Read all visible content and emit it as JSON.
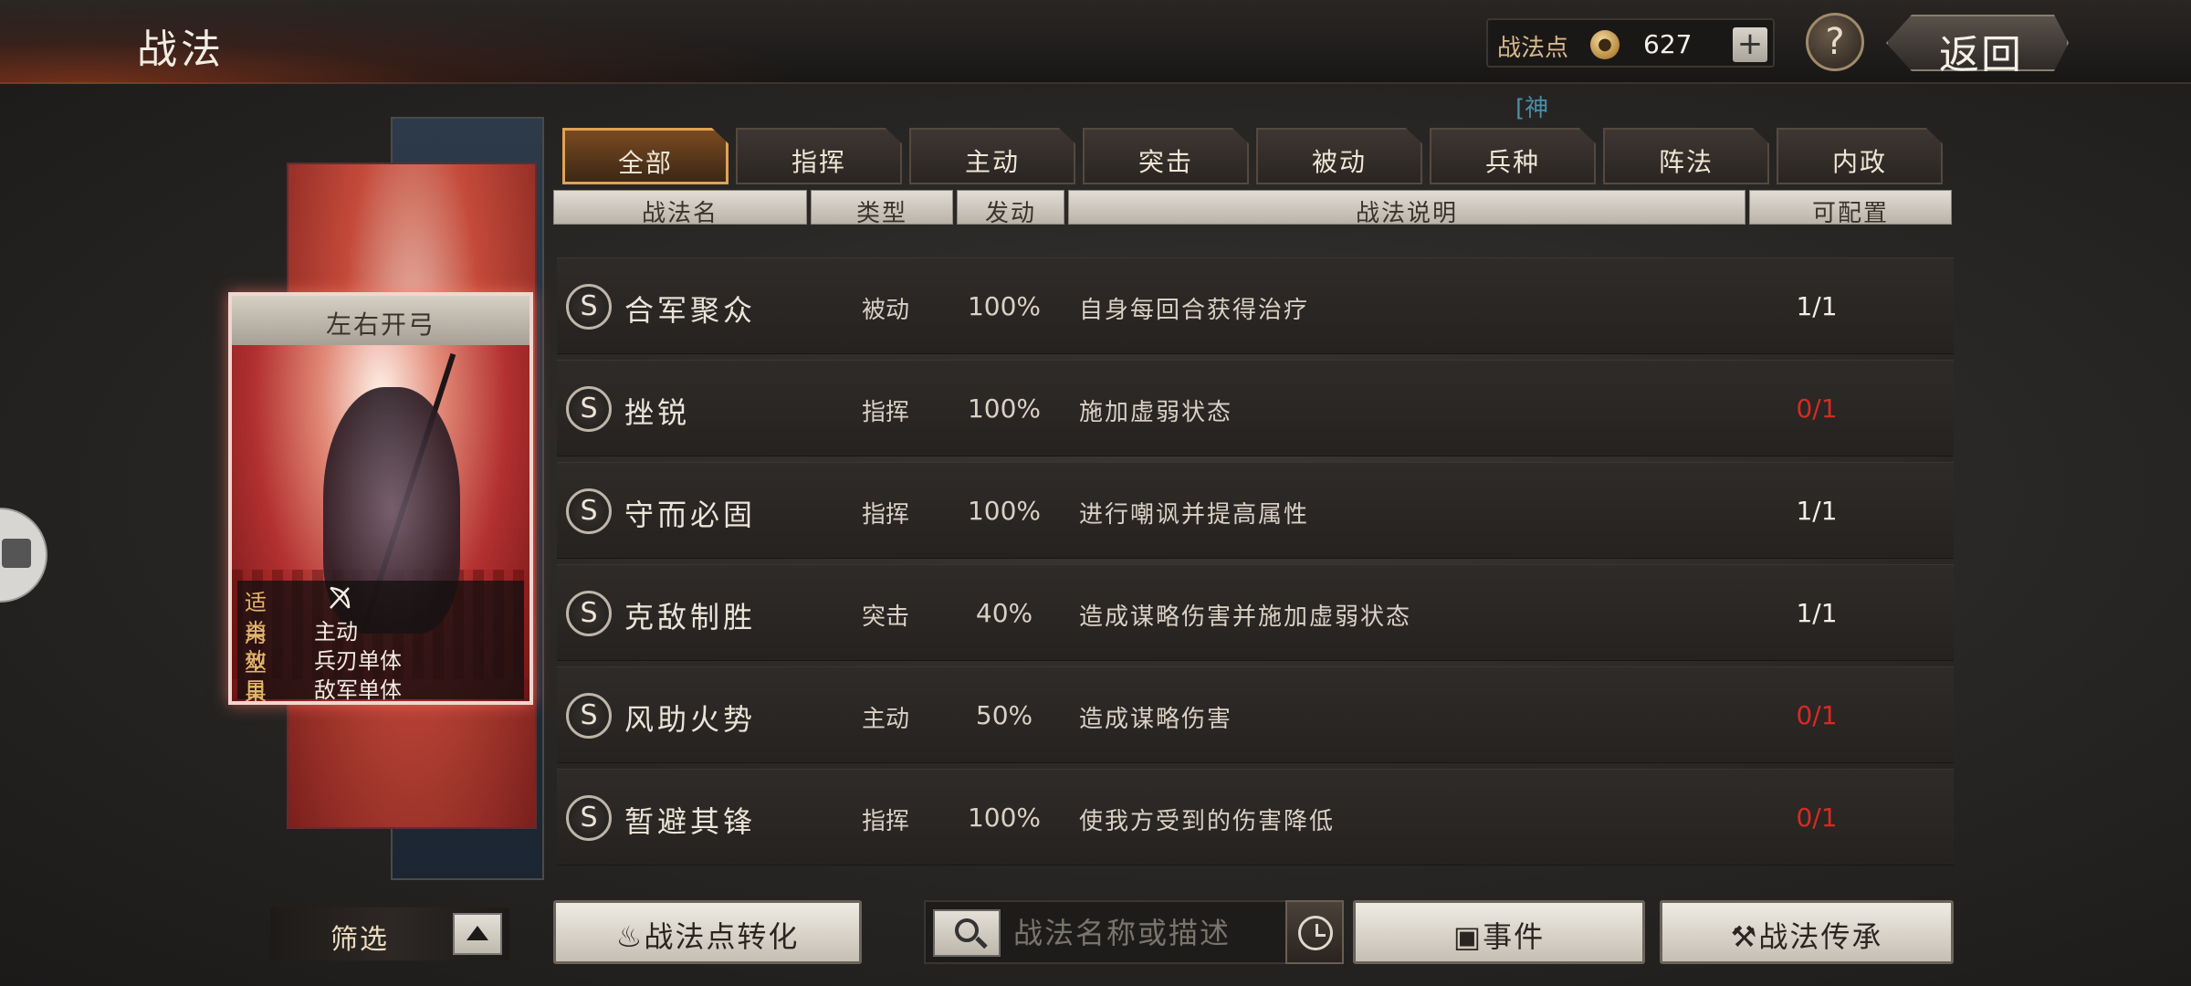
{
  "header": {
    "title": "战法",
    "points_label": "战法点",
    "points_value": "627",
    "points_add": "+",
    "help": "?",
    "back": "返回",
    "hint": "[神"
  },
  "card": {
    "title": "左右开弓",
    "info": [
      {
        "key": "适用",
        "value": ""
      },
      {
        "key": "类型",
        "value": "主动"
      },
      {
        "key": "效果",
        "value": "兵刃单体"
      },
      {
        "key": "目标",
        "value": "敌军单体"
      }
    ],
    "applicable_icon": "bow-crossed-icon"
  },
  "tabs": [
    {
      "label": "全部",
      "active": true
    },
    {
      "label": "指挥",
      "active": false
    },
    {
      "label": "主动",
      "active": false
    },
    {
      "label": "突击",
      "active": false
    },
    {
      "label": "被动",
      "active": false
    },
    {
      "label": "兵种",
      "active": false
    },
    {
      "label": "阵法",
      "active": false
    },
    {
      "label": "内政",
      "active": false
    }
  ],
  "columns": {
    "name": "战法名",
    "type": "类型",
    "rate": "发动",
    "desc": "战法说明",
    "count": "可配置"
  },
  "rows": [
    {
      "grade": "S",
      "name": "合军聚众",
      "type": "被动",
      "rate": "100%",
      "desc": "自身每回合获得治疗",
      "count": "1/1",
      "available": true
    },
    {
      "grade": "S",
      "name": "挫锐",
      "type": "指挥",
      "rate": "100%",
      "desc": "施加虚弱状态",
      "count": "0/1",
      "available": false
    },
    {
      "grade": "S",
      "name": "守而必固",
      "type": "指挥",
      "rate": "100%",
      "desc": "进行嘲讽并提高属性",
      "count": "1/1",
      "available": true
    },
    {
      "grade": "S",
      "name": "克敌制胜",
      "type": "突击",
      "rate": "40%",
      "desc": "造成谋略伤害并施加虚弱状态",
      "count": "1/1",
      "available": true
    },
    {
      "grade": "S",
      "name": "风助火势",
      "type": "主动",
      "rate": "50%",
      "desc": "造成谋略伤害",
      "count": "0/1",
      "available": false
    },
    {
      "grade": "S",
      "name": "暂避其锋",
      "type": "指挥",
      "rate": "100%",
      "desc": "使我方受到的伤害降低",
      "count": "0/1",
      "available": false
    }
  ],
  "bottom": {
    "filter": "筛选",
    "convert": "战法点转化",
    "search_placeholder": "战法名称或描述",
    "events": "事件",
    "inherit": "战法传承"
  },
  "colors": {
    "accent": "#e0a255",
    "unavailable": "#d92a22",
    "available": "#f4efe6"
  }
}
